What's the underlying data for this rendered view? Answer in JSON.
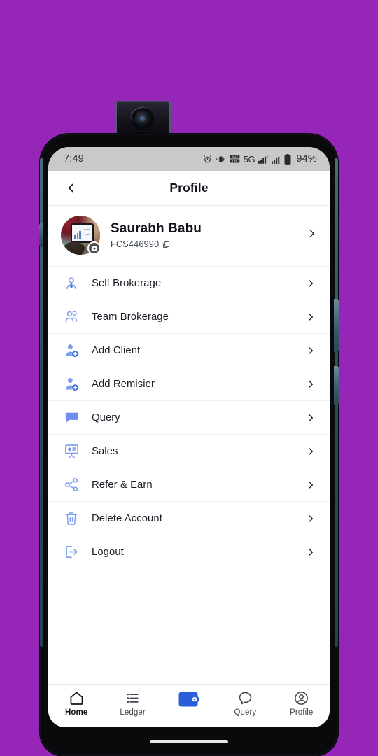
{
  "theme": {
    "wallpaper_color": "#9626b8",
    "accent_blue": "#3b6fe0",
    "icon_blue": "#7e9cf0",
    "status_bar_bg": "#c9c9c9",
    "screen_bg": "#ffffff"
  },
  "status_bar": {
    "time": "7:49",
    "battery_percent": "94%",
    "network_label": "5G",
    "volte_label": "VoLTE",
    "icons": [
      "alarm-icon",
      "vibrate-icon",
      "volte-icon",
      "5g-icon",
      "signal-bars-sim1-icon",
      "signal-bars-sim2-icon",
      "battery-icon"
    ]
  },
  "header": {
    "title": "Profile",
    "back_icon": "chevron-left-icon"
  },
  "profile": {
    "name": "Saurabh Babu",
    "client_id": "FCS446990",
    "copy_icon": "copy-icon",
    "avatar_icon": "avatar",
    "camera_badge_icon": "camera-icon",
    "chevron_icon": "chevron-right-icon"
  },
  "menu": {
    "items": [
      {
        "label": "Self Brokerage",
        "icon": "person-arrow-down-icon"
      },
      {
        "label": "Team Brokerage",
        "icon": "people-group-icon"
      },
      {
        "label": "Add Client",
        "icon": "person-add-icon"
      },
      {
        "label": "Add Remisier",
        "icon": "person-add-icon"
      },
      {
        "label": "Query",
        "icon": "chat-bubble-icon"
      },
      {
        "label": "Sales",
        "icon": "presentation-board-icon"
      },
      {
        "label": "Refer & Earn",
        "icon": "share-nodes-icon"
      },
      {
        "label": "Delete Account",
        "icon": "trash-icon"
      },
      {
        "label": "Logout",
        "icon": "logout-arrow-icon"
      }
    ],
    "chevron_icon": "chevron-right-icon"
  },
  "bottom_nav": {
    "items": [
      {
        "label": "Home",
        "icon": "home-icon",
        "active": true
      },
      {
        "label": "Ledger",
        "icon": "list-icon",
        "active": false
      },
      {
        "label": "",
        "icon": "wallet-icon",
        "active": false
      },
      {
        "label": "Query",
        "icon": "chat-icon",
        "active": false
      },
      {
        "label": "Profile",
        "icon": "user-circle-icon",
        "active": false
      }
    ]
  },
  "device": {
    "popup_camera_icon": "popup-selfie-camera",
    "buttons": [
      "volume-button",
      "power-button",
      "sim-tray"
    ],
    "gesture_bar": "home-indicator"
  }
}
